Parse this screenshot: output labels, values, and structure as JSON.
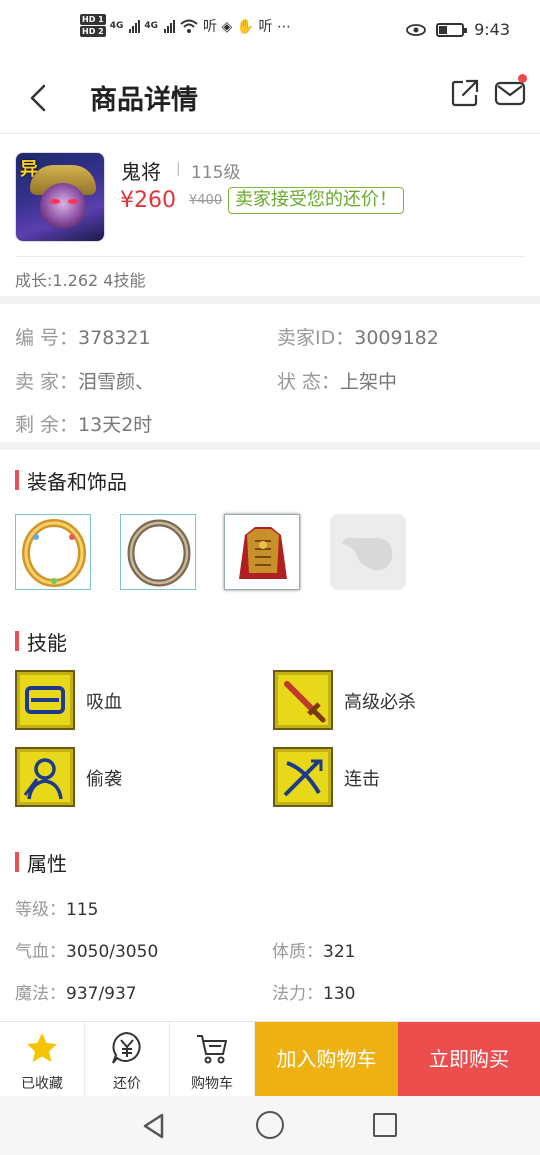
{
  "status_bar": {
    "hd1": "HD 1",
    "hd2": "HD 2",
    "net1": "4G",
    "net2": "4G",
    "app_icons": "听 ◈ ✋ 听 ⋯",
    "time": "9:43"
  },
  "header": {
    "title": "商品详情"
  },
  "product": {
    "badge": "异",
    "name": "鬼将",
    "separator": "|",
    "level": "115级",
    "price": "¥260",
    "original_price": "¥400",
    "offer_text": "卖家接受您的还价！",
    "growth": "成长:1.262 4技能"
  },
  "info": {
    "id_label": "编  号：",
    "id_value": "378321",
    "seller_id_label": "卖家ID：",
    "seller_id_value": "3009182",
    "seller_label": "卖  家：",
    "seller_value": "泪雪颜、",
    "status_label": "状  态：",
    "status_value": "上架中",
    "remaining_label": "剩  余：",
    "remaining_value": "13天2时"
  },
  "sections": {
    "equipment": "装备和饰品",
    "skills": "技能",
    "attributes": "属性"
  },
  "skills": [
    {
      "name": "吸血",
      "icon": "vampire-skill-icon"
    },
    {
      "name": "高级必杀",
      "icon": "sword-skill-icon"
    },
    {
      "name": "偷袭",
      "icon": "ambush-skill-icon"
    },
    {
      "name": "连击",
      "icon": "combo-skill-icon"
    }
  ],
  "attributes": {
    "level_label": "等级：",
    "level_value": "115",
    "hp_label": "气血：",
    "hp_value": "3050/3050",
    "con_label": "体质：",
    "con_value": "321",
    "mp_label": "魔法：",
    "mp_value": "937/937",
    "mag_label": "法力：",
    "mag_value": "130"
  },
  "bottom_bar": {
    "favorite_label": "已收藏",
    "bargain_label": "还价",
    "cart_label": "购物车",
    "add_to_cart": "加入购物车",
    "buy_now": "立即购买"
  },
  "colors": {
    "price": "#e0353b",
    "offer_green": "#6aaa2c",
    "accent_bar": "#e8505b",
    "add_cart_bg": "#efb112",
    "buy_now_bg": "#ec4e4e",
    "favorite_star": "#f5c400"
  }
}
